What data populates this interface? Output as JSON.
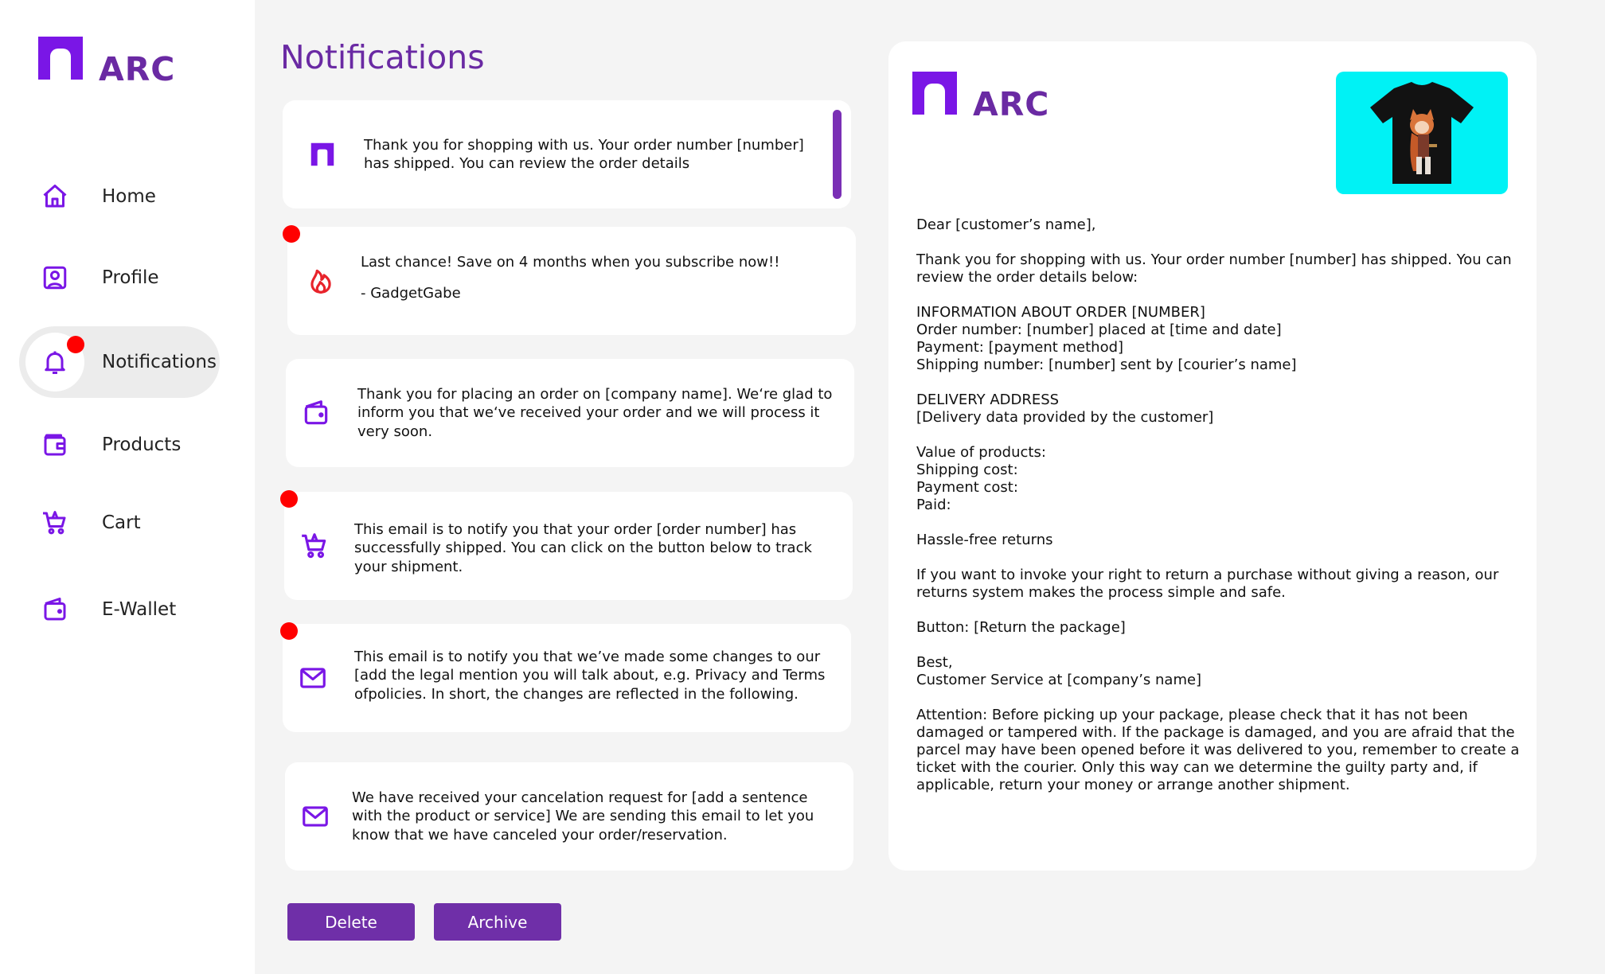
{
  "brand": {
    "name": "ARC"
  },
  "colors": {
    "accent": "#6a2aa3",
    "icon": "#7a16e6",
    "unread": "#ff0000",
    "product_bg": "#00f2f5"
  },
  "sidebar": {
    "items": [
      {
        "label": "Home",
        "icon": "home-icon"
      },
      {
        "label": "Profile",
        "icon": "profile-icon"
      },
      {
        "label": "Notifications",
        "icon": "bell-icon",
        "active": true
      },
      {
        "label": "Products",
        "icon": "products-icon"
      },
      {
        "label": "Cart",
        "icon": "cart-icon"
      },
      {
        "label": "E-Wallet",
        "icon": "wallet-icon"
      }
    ]
  },
  "page": {
    "title": "Notifications"
  },
  "notifications": [
    {
      "icon": "arc-logo-icon",
      "unread": false,
      "text": "Thank you for shopping with us. Your order number [number] has shipped. You can review the order details"
    },
    {
      "icon": "fire-icon",
      "unread": true,
      "text": "Last chance! Save on 4 months when you subscribe now!!",
      "signature": "- GadgetGabe"
    },
    {
      "icon": "wallet-icon",
      "unread": false,
      "text": "Thank you for placing an order on [company name]. We‘re glad to inform you that we‘ve received your order and we will process it very soon."
    },
    {
      "icon": "cart-icon",
      "unread": true,
      "text": "This email is to notify you that your order [order number] has successfully shipped. You can click on the button below to track your shipment."
    },
    {
      "icon": "mail-icon",
      "unread": true,
      "text": "This email is to notify you that we’ve made some changes to our [add the legal mention you will talk about, e.g. Privacy and Terms ofpolicies. In short, the changes are reflected in the following."
    },
    {
      "icon": "mail-icon",
      "unread": false,
      "text": "We have received your cancelation request for [add a sentence with the product or service] We are sending this email to let you know that we have canceled your order/reservation."
    }
  ],
  "actions": {
    "delete_label": "Delete",
    "archive_label": "Archive"
  },
  "detail": {
    "body": "Dear [customer’s name],\n\nThank you for shopping with us. Your order number [number] has shipped. You can review the order details below:\n\nINFORMATION ABOUT ORDER [NUMBER]\nOrder number: [number] placed at [time and date]\nPayment: [payment method]\nShipping number: [number] sent by [courier’s name]\n\nDELIVERY ADDRESS\n[Delivery data provided by the customer]\n\nValue of products:\nShipping cost:\nPayment cost:\nPaid:\n\nHassle-free returns\n\nIf you want to invoke your right to return a purchase without giving a reason, our returns system makes the process simple and safe.\n\nButton: [Return the package]\n\nBest,\nCustomer Service at [company’s name]\n\nAttention: Before picking up your package, please check that it has not been damaged or tampered with. If the package is damaged, and you are afraid that the parcel may have been opened before it was delivered to you, remember to create a ticket with the courier. Only this way can we determine the guilty party and, if applicable, return your money or arrange another shipment."
  }
}
